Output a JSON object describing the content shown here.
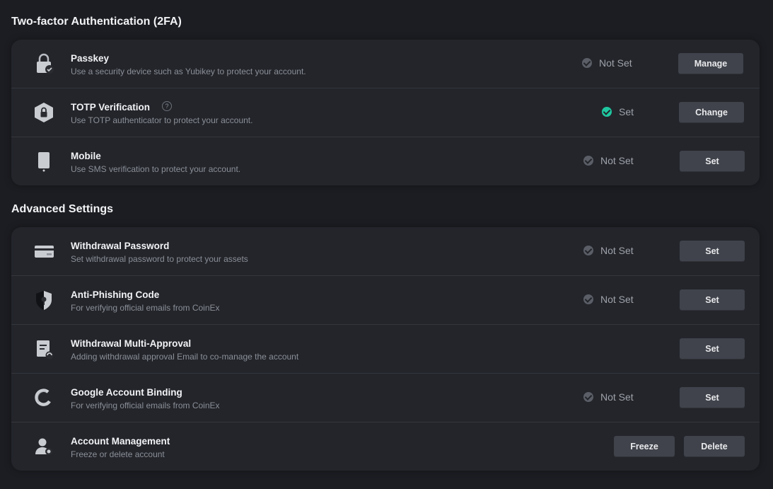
{
  "sections": {
    "twofa": {
      "title": "Two-factor Authentication (2FA)",
      "items": [
        {
          "title": "Passkey",
          "desc": "Use a security device such as Yubikey to protect your account.",
          "status": "Not Set",
          "button": "Manage",
          "icon": "lock-check-icon"
        },
        {
          "title": "TOTP Verification",
          "desc": "Use TOTP authenticator to protect your account.",
          "status": "Set",
          "button": "Change",
          "help": "?",
          "icon": "hexagon-lock-icon"
        },
        {
          "title": "Mobile",
          "desc": "Use SMS verification to protect your account.",
          "status": "Not Set",
          "button": "Set",
          "icon": "mobile-phone-icon"
        }
      ]
    },
    "advanced": {
      "title": "Advanced Settings",
      "items": [
        {
          "title": "Withdrawal Password",
          "desc": "Set withdrawal password to protect your assets",
          "status": "Not Set",
          "button": "Set",
          "icon": "card-icon"
        },
        {
          "title": "Anti-Phishing Code",
          "desc": "For verifying official emails from CoinEx",
          "status": "Not Set",
          "button": "Set",
          "icon": "shield-key-icon"
        },
        {
          "title": "Withdrawal Multi-Approval",
          "desc": "Adding withdrawal approval Email to co-manage the account",
          "button": "Set",
          "icon": "document-approval-icon"
        },
        {
          "title": "Google Account Binding",
          "desc": "For verifying official emails from CoinEx",
          "status": "Not Set",
          "button": "Set",
          "icon": "google-icon"
        },
        {
          "title": "Account Management",
          "desc": "Freeze or delete account",
          "button_freeze": "Freeze",
          "button_delete": "Delete",
          "icon": "user-settings-icon"
        }
      ]
    }
  },
  "colors": {
    "background": "#1c1d22",
    "card": "#23252b",
    "button": "#40434b",
    "status_set": "#1fc7a0",
    "status_not_set": "#5b5e66"
  }
}
